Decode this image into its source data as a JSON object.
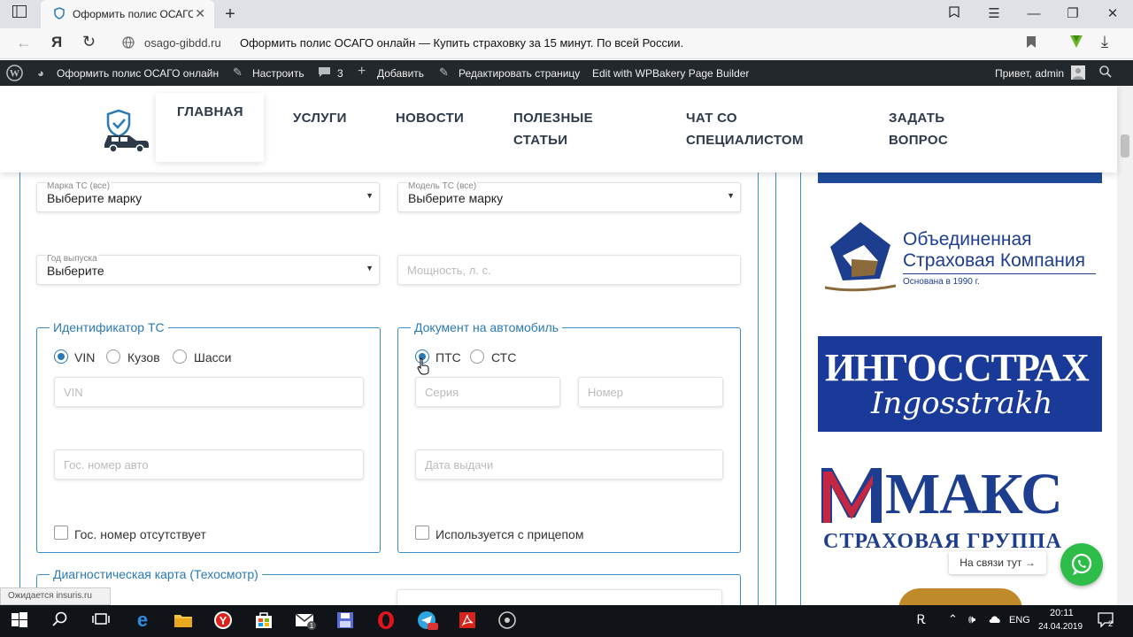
{
  "browser": {
    "tab_title": "Оформить полис ОСАГО",
    "url_domain": "osago-gibdd.ru",
    "url_title": "Оформить полис ОСАГО онлайн — Купить страховку за 15 минут. По всей России."
  },
  "wp_admin_bar": {
    "site_name": "Оформить полис ОСАГО онлайн",
    "customize": "Настроить",
    "comments_count": "3",
    "add_new": "Добавить",
    "edit_page": "Редактировать страницу",
    "wpbakery": "Edit with WPBakery Page Builder",
    "greeting": "Привет, admin"
  },
  "nav": {
    "home": "ГЛАВНАЯ",
    "services": "УСЛУГИ",
    "news": "НОВОСТИ",
    "articles_1": "ПОЛЕЗНЫЕ",
    "articles_2": "СТАТЬИ",
    "chat_1": "ЧАТ СО",
    "chat_2": "СПЕЦИАЛИСТОМ",
    "ask_1": "ЗАДАТЬ",
    "ask_2": "ВОПРОС"
  },
  "form": {
    "brand_label": "Марка ТС (все)",
    "brand_value": "Выберите марку",
    "model_label": "Модель ТС (все)",
    "model_value": "Выберите марку",
    "year_label": "Год выпуска",
    "year_value": "Выберите",
    "power_placeholder": "Мощность, л. с.",
    "vehicle_id": {
      "legend": "Идентификатор ТС",
      "options": [
        "VIN",
        "Кузов",
        "Шасси"
      ],
      "selected": "VIN",
      "vin_placeholder": "VIN",
      "plate_placeholder": "Гос. номер авто",
      "no_plate_label": "Гос. номер отсутствует"
    },
    "vehicle_doc": {
      "legend": "Документ на автомобиль",
      "options": [
        "ПТС",
        "СТС"
      ],
      "selected": "ПТС",
      "series_placeholder": "Серия",
      "number_placeholder": "Номер",
      "issue_date_placeholder": "Дата выдачи",
      "trailer_label": "Используется с прицепом"
    },
    "diag_legend": "Диагностическая карта (Техосмотр)"
  },
  "sidebar": {
    "logo1_line1": "Объединенная",
    "logo1_line2": "Страховая Компания",
    "logo1_line3": "Основана в 1990 г.",
    "logo2_line1": "ИНГОССТРАХ",
    "logo2_line2": "Ingosstrakh",
    "logo3_line1": "МАКС",
    "logo3_line2": "СТРАХОВАЯ ГРУППА"
  },
  "whatsapp_label": "На связи тут →",
  "status_text": "Ожидается insuris.ru",
  "taskbar": {
    "lang": "ENG",
    "time": "20:11",
    "date": "24.04.2019",
    "notif_count": "2"
  },
  "colors": {
    "accent": "#2a7ab5",
    "frame": "#3a8fc7",
    "wp_bar": "#23282d",
    "ingos_blue": "#1a3a9a",
    "maks_blue": "#1d3d8f",
    "maks_red": "#d8243a",
    "whatsapp": "#2fbd49"
  }
}
